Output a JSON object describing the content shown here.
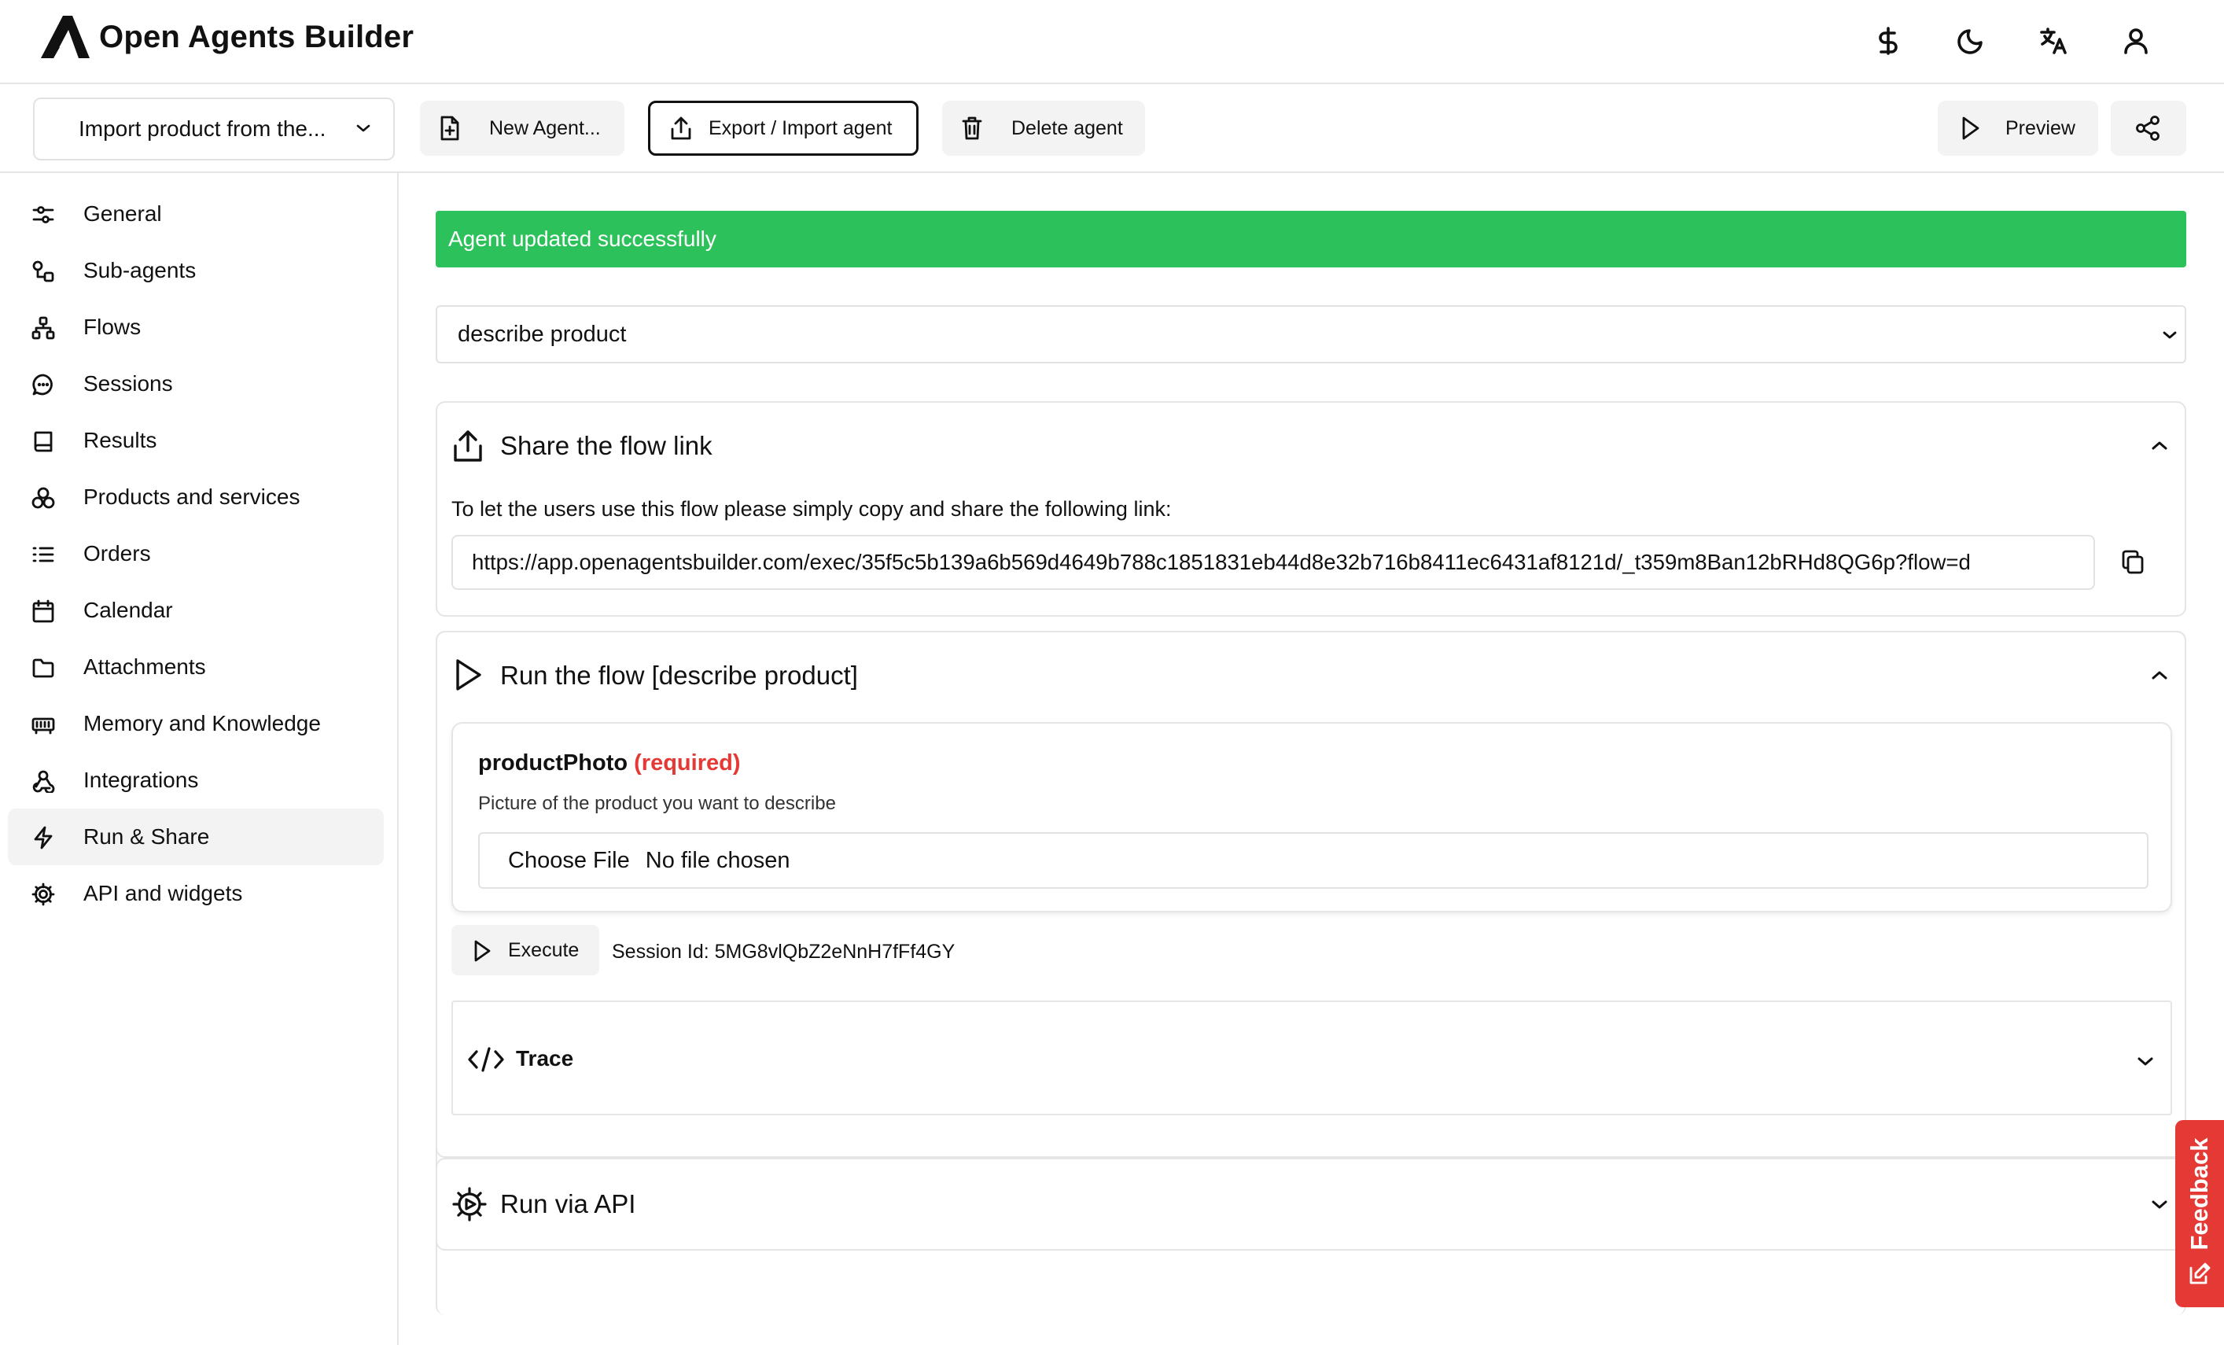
{
  "app": {
    "title": "Open Agents Builder"
  },
  "colors": {
    "success": "#2cc15a",
    "required": "#e53935",
    "feedback": "#e53935",
    "active_bg": "#f3f3f3"
  },
  "header": {
    "icons": [
      "dollar-icon",
      "moon-icon",
      "translate-icon",
      "user-icon"
    ]
  },
  "toolbar": {
    "agent_select": "Import product from the...",
    "new_agent": "New Agent...",
    "export_import": "Export / Import agent",
    "delete_agent": "Delete agent",
    "preview": "Preview"
  },
  "sidebar": {
    "active": "Run & Share",
    "items": [
      {
        "label": "General",
        "icon": "sliders-icon"
      },
      {
        "label": "Sub-agents",
        "icon": "sub-agents-icon"
      },
      {
        "label": "Flows",
        "icon": "flows-icon"
      },
      {
        "label": "Sessions",
        "icon": "chat-icon"
      },
      {
        "label": "Results",
        "icon": "book-icon"
      },
      {
        "label": "Products and services",
        "icon": "products-icon"
      },
      {
        "label": "Orders",
        "icon": "list-icon"
      },
      {
        "label": "Calendar",
        "icon": "calendar-icon"
      },
      {
        "label": "Attachments",
        "icon": "folder-icon"
      },
      {
        "label": "Memory and Knowledge",
        "icon": "memory-icon"
      },
      {
        "label": "Integrations",
        "icon": "webhook-icon"
      },
      {
        "label": "Run & Share",
        "icon": "bolt-icon"
      },
      {
        "label": "API and widgets",
        "icon": "gear-icon"
      }
    ]
  },
  "main": {
    "alert": "Agent updated successfully",
    "flow_select": "describe product",
    "share": {
      "title": "Share the flow link",
      "text": "To let the users use this flow please simply copy and share the following link:",
      "link": "https://app.openagentsbuilder.com/exec/35f5c5b139a6b569d4649b788c1851831eb44d8e32b716b8411ec6431af8121d/_t359m8Ban12bRHd8QG6p?flow=d"
    },
    "run": {
      "title": "Run the flow [describe product]",
      "param_name": "productPhoto",
      "param_required": "(required)",
      "param_desc": "Picture of the product you want to describe",
      "file_button": "Choose File",
      "file_status": "No file chosen",
      "execute": "Execute",
      "session": "Session Id: 5MG8vlQbZ2eNnH7fFf4GY",
      "trace": "Trace"
    },
    "api": {
      "title": "Run via API"
    }
  },
  "feedback": {
    "label": "Feedback"
  }
}
